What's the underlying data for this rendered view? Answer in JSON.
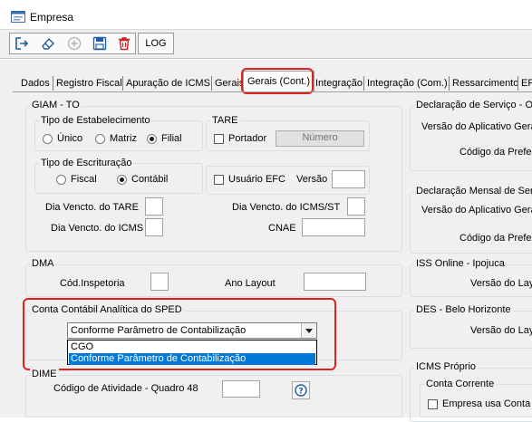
{
  "window": {
    "title": "Empresa"
  },
  "toolbar": {
    "icons": [
      "exit-icon",
      "eraser-icon",
      "add-icon",
      "save-icon",
      "delete-icon"
    ],
    "log_label": "LOG"
  },
  "tabs": [
    {
      "label": "Dados"
    },
    {
      "label": "Registro Fiscal"
    },
    {
      "label": "Apuração de ICMS"
    },
    {
      "label": "Gerais"
    },
    {
      "label": "Gerais (Cont.)",
      "active": true
    },
    {
      "label": "Integração"
    },
    {
      "label": "Integração (Com.)"
    },
    {
      "label": "Ressarcimento"
    },
    {
      "label": "EF"
    }
  ],
  "giam": {
    "title": "GIAM - TO",
    "estab": {
      "title": "Tipo de Estabelecimento",
      "options": [
        "Único",
        "Matriz",
        "Filial"
      ],
      "selected": "Filial"
    },
    "tare": {
      "title": "TARE",
      "portador": "Portador",
      "numero": "Número"
    },
    "escrit": {
      "title": "Tipo de Escrituração",
      "options": [
        "Fiscal",
        "Contábil"
      ],
      "selected": "Contábil"
    },
    "usuario_efc": "Usuário EFC",
    "versao": "Versão",
    "dia_tare": "Dia Vencto. do TARE",
    "dia_icms_st": "Dia Vencto. do ICMS/ST",
    "dia_icms": "Dia Vencto. do ICMS",
    "cnae": "CNAE"
  },
  "dma": {
    "title": "DMA",
    "cod_inspetoria": "Cód.Inspetoria",
    "ano_layout": "Ano Layout"
  },
  "sped": {
    "title": "Conta Contábil Analítica do SPED",
    "selected": "Conforme Parâmetro de Contabilização",
    "options": [
      "CGO",
      "Conforme Parâmetro de Contabilização"
    ]
  },
  "dime": {
    "title": "DIME",
    "codigo": "Código de Atividade - Quadro 48"
  },
  "right": {
    "decl_servico": {
      "title": "Declaração de Serviço - O",
      "versao": "Versão do Aplicativo Gera",
      "codigo": "Código da Prefei"
    },
    "decl_mensal": {
      "title": "Declaração Mensal de Serv",
      "versao": "Versão do Aplicativo Gera",
      "codigo": "Código da Prefei"
    },
    "iss_online": {
      "title": "ISS Online - Ipojuca",
      "versao": "Versão do Lay"
    },
    "des": {
      "title": "DES - Belo Horizonte",
      "versao": "Versão do Lay"
    },
    "icms_proprio": {
      "title": "ICMS Próprio",
      "conta_corrente": "Conta Corrente",
      "usa_conta": "Empresa usa Conta I"
    }
  }
}
